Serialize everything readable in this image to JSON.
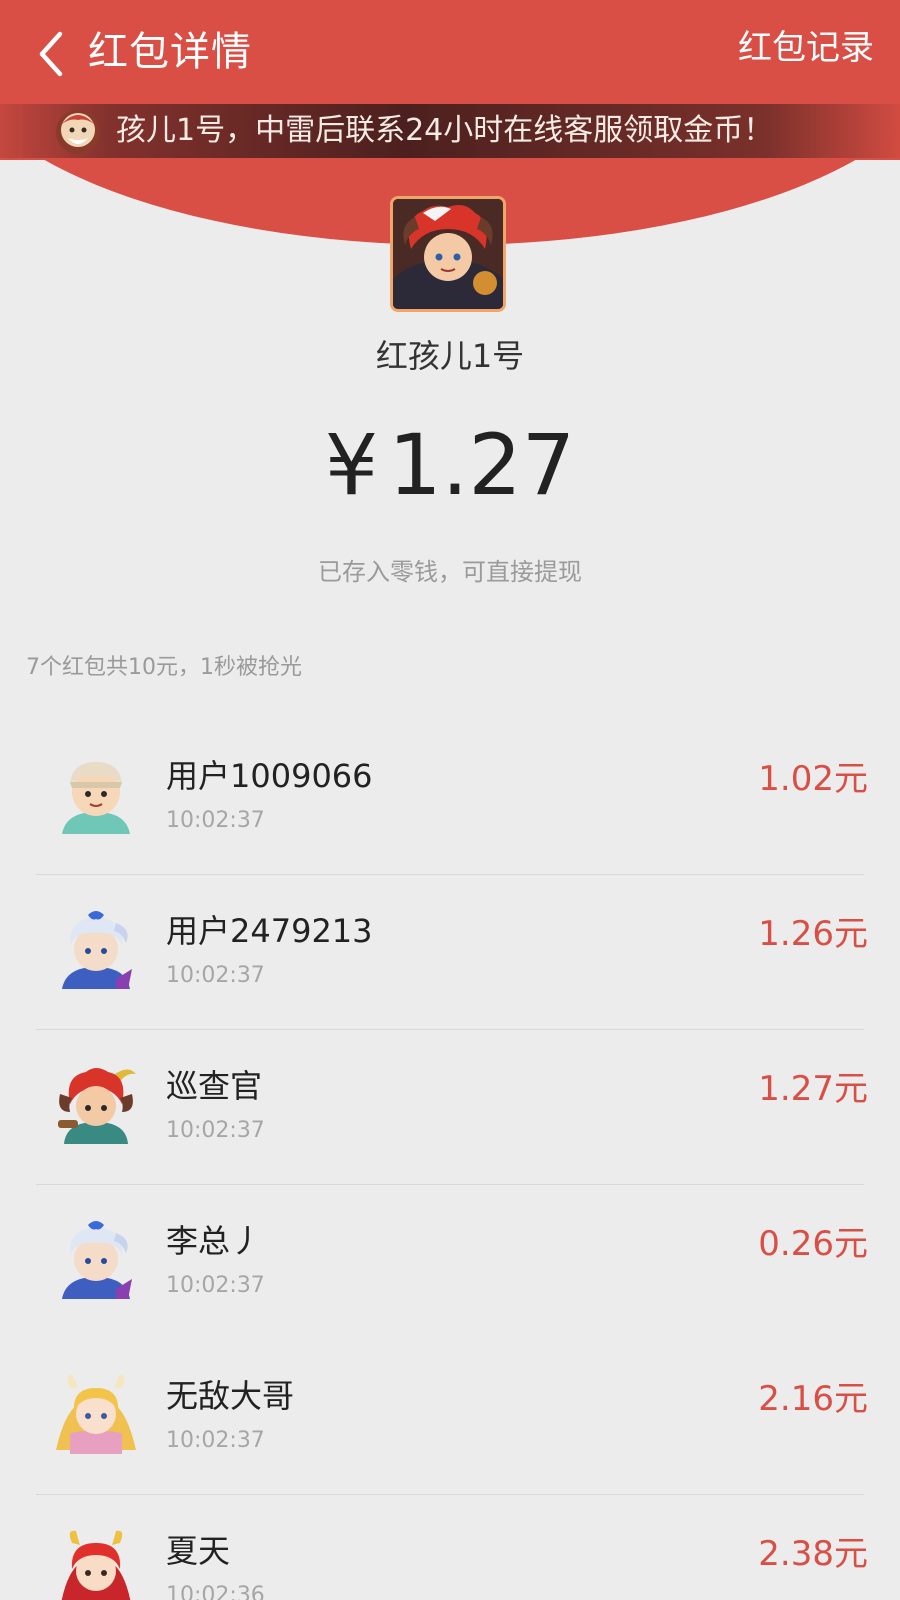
{
  "topbar": {
    "title": "红包详情",
    "records_label": "红包记录"
  },
  "notice": {
    "text": "孩儿1号，中雷后联系24小时在线客服领取金币！"
  },
  "sender": {
    "name": "红孩儿1号",
    "amount_symbol": "¥",
    "amount": "1.27",
    "deposit_note": "已存入零钱，可直接提现"
  },
  "summary": "7个红包共10元，1秒被抢光",
  "colors": {
    "brand_red": "#d94f45",
    "amount_red": "#d94f45",
    "background": "#ececec"
  },
  "list": [
    {
      "name": "用户1009066",
      "time": "10:02:37",
      "amount": "1.02元",
      "avatar": "old-man-avatar"
    },
    {
      "name": "用户2479213",
      "time": "10:02:37",
      "amount": "1.26元",
      "avatar": "blue-hair-avatar"
    },
    {
      "name": "巡查官",
      "time": "10:02:37",
      "amount": "1.27元",
      "avatar": "red-demon-avatar"
    },
    {
      "name": "李总丿",
      "time": "10:02:37",
      "amount": "0.26元",
      "avatar": "blue-hair-avatar"
    },
    {
      "name": "无敌大哥",
      "time": "10:02:37",
      "amount": "2.16元",
      "avatar": "blonde-girl-avatar"
    },
    {
      "name": "夏天",
      "time": "10:02:36",
      "amount": "2.38元",
      "avatar": "red-hair-girl-avatar"
    }
  ]
}
